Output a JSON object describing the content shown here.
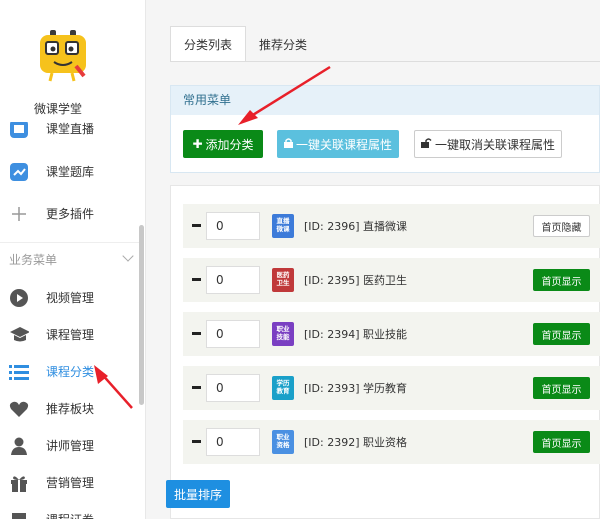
{
  "sidebar": {
    "brand": "微课学堂",
    "items_top": [
      {
        "label": "课堂直播",
        "icon": "live-icon"
      },
      {
        "label": "课堂题库",
        "icon": "question-bank-icon"
      },
      {
        "label": "更多插件",
        "icon": "plus-icon"
      }
    ],
    "section_label": "业务菜单",
    "items": [
      {
        "label": "视频管理",
        "icon": "play-icon"
      },
      {
        "label": "课程管理",
        "icon": "mortarboard-icon"
      },
      {
        "label": "课程分类",
        "icon": "list-icon"
      },
      {
        "label": "推荐板块",
        "icon": "heart-icon"
      },
      {
        "label": "讲师管理",
        "icon": "teacher-icon"
      },
      {
        "label": "营销管理",
        "icon": "gift-icon"
      },
      {
        "label": "课程证券",
        "icon": "certificate-icon"
      }
    ]
  },
  "tabs": [
    {
      "label": "分类列表",
      "active": true
    },
    {
      "label": "推荐分类",
      "active": false
    }
  ],
  "common_menu": {
    "title": "常用菜单",
    "add_label": "添加分类",
    "link_label": "一键关联课程属性",
    "unlink_label": "一键取消关联课程属性"
  },
  "categories": [
    {
      "order": "0",
      "thumb": "直播\n微课",
      "color": "#3d7bd9",
      "name": "[ID: 2396] 直播微课",
      "action": "首页隐藏",
      "shown": false
    },
    {
      "order": "0",
      "thumb": "医药\n卫生",
      "color": "#c0393a",
      "name": "[ID: 2395] 医药卫生",
      "action": "首页显示",
      "shown": true
    },
    {
      "order": "0",
      "thumb": "职业\n技能",
      "color": "#7a3fc2",
      "name": "[ID: 2394] 职业技能",
      "action": "首页显示",
      "shown": true
    },
    {
      "order": "0",
      "thumb": "学历\n教育",
      "color": "#1aa0c9",
      "name": "[ID: 2393] 学历教育",
      "action": "首页显示",
      "shown": true
    },
    {
      "order": "0",
      "thumb": "职业\n资格",
      "color": "#4a90e2",
      "name": "[ID: 2392] 职业资格",
      "action": "首页显示",
      "shown": true
    }
  ],
  "batch_sort_label": "批量排序",
  "colors": {
    "accent": "#2f8ee0",
    "green": "#0a8a17",
    "cyan": "#5bc0de",
    "arrow": "#e8202a"
  }
}
